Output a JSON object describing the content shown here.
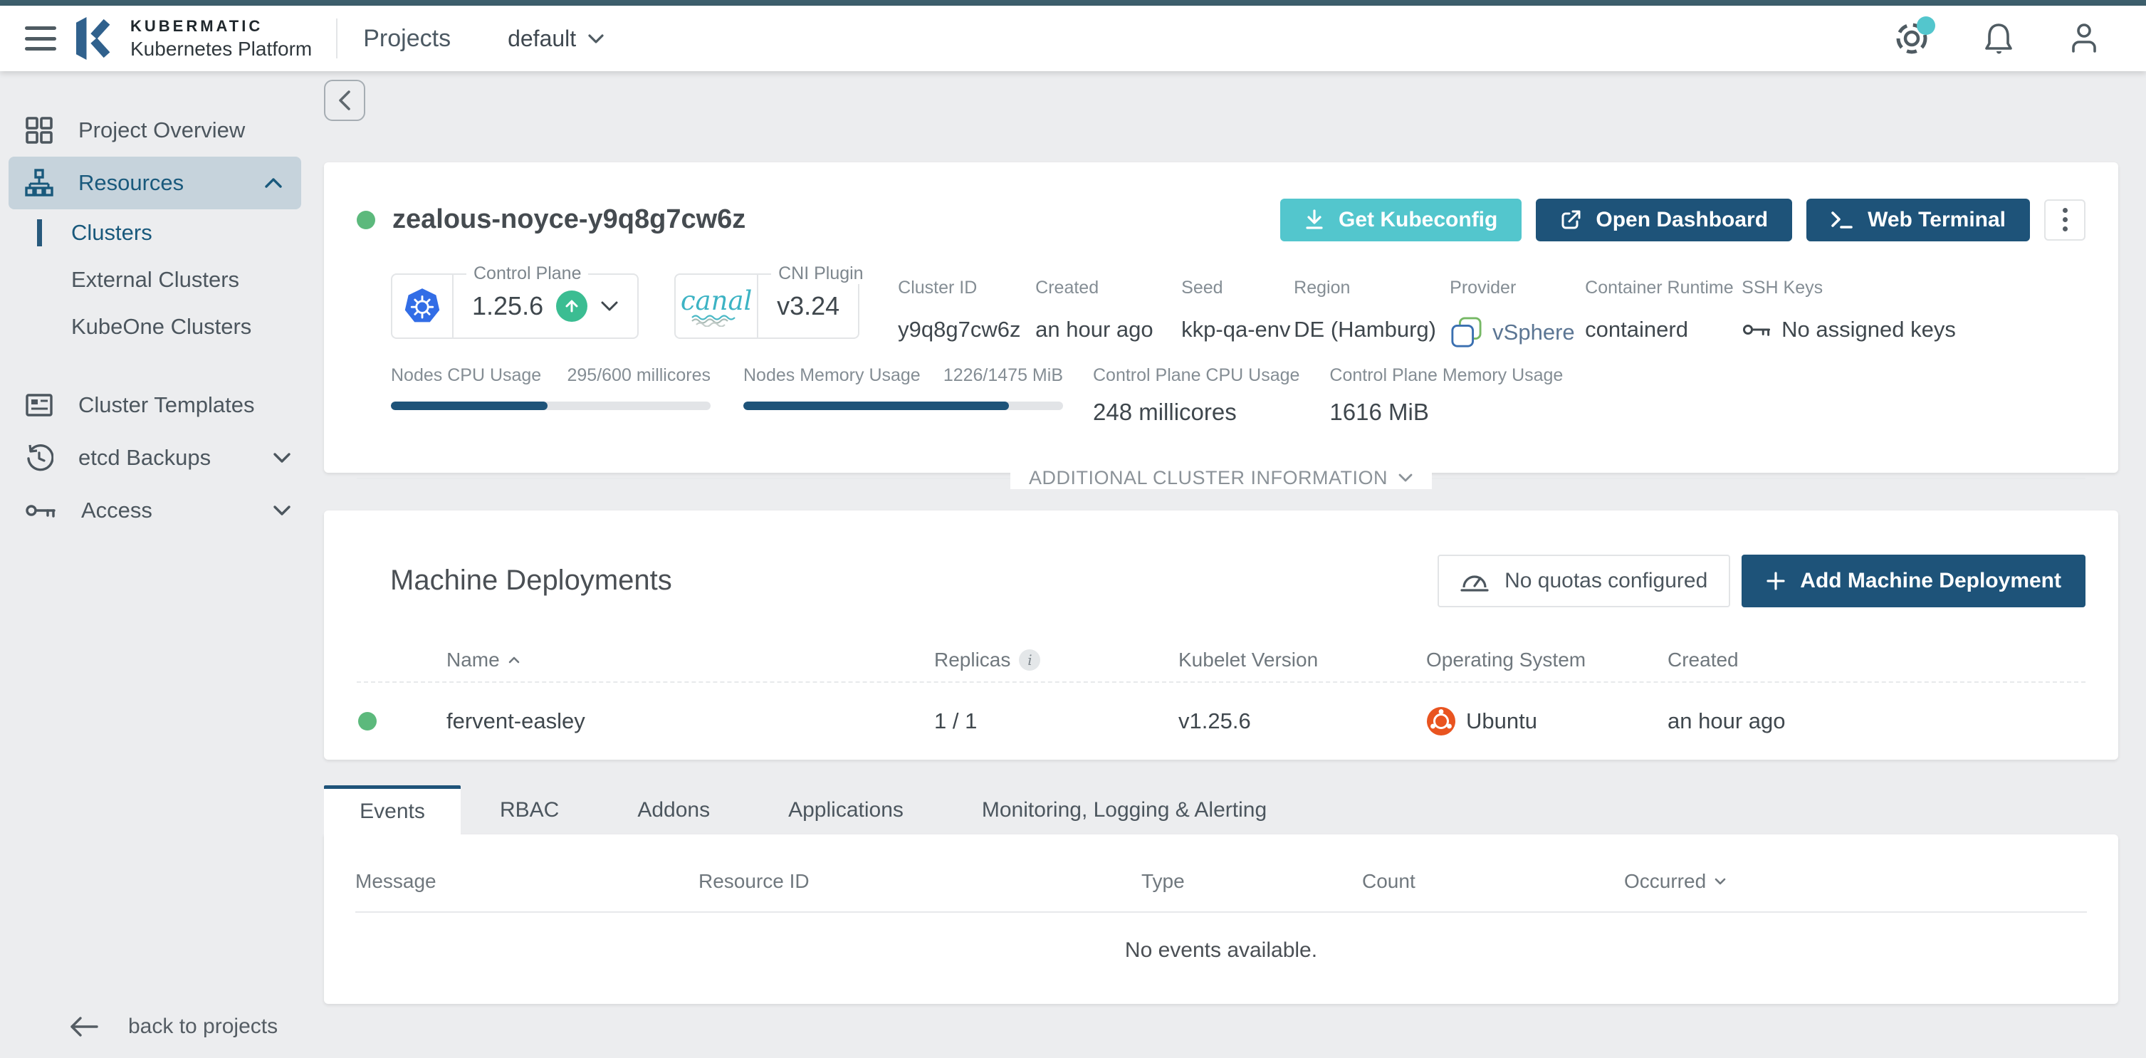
{
  "topbar": {
    "brand_line1": "KUBERMATIC",
    "brand_line2": "Kubernetes Platform",
    "nav_title": "Projects",
    "project_selector": "default"
  },
  "sidebar": {
    "items": [
      {
        "label": "Project Overview"
      },
      {
        "label": "Resources"
      },
      {
        "label": "Clusters"
      },
      {
        "label": "External Clusters"
      },
      {
        "label": "KubeOne Clusters"
      },
      {
        "label": "Cluster Templates"
      },
      {
        "label": "etcd Backups"
      },
      {
        "label": "Access"
      }
    ],
    "back_link": "back to projects"
  },
  "cluster": {
    "name": "zealous-noyce-y9q8g7cw6z",
    "status": "healthy",
    "actions": {
      "kubeconfig": "Get Kubeconfig",
      "dashboard": "Open Dashboard",
      "terminal": "Web Terminal"
    },
    "control_plane": {
      "label": "Control Plane",
      "version": "1.25.6"
    },
    "cni": {
      "label": "CNI Plugin",
      "logo_text": "canal",
      "version": "v3.24"
    },
    "attributes": [
      {
        "label": "Cluster ID",
        "value": "y9q8g7cw6z"
      },
      {
        "label": "Created",
        "value": "an hour ago"
      },
      {
        "label": "Seed",
        "value": "kkp-qa-env"
      },
      {
        "label": "Region",
        "value": "DE (Hamburg)"
      },
      {
        "label": "Provider",
        "value": "vSphere"
      },
      {
        "label": "Container Runtime",
        "value": "containerd"
      },
      {
        "label": "SSH Keys",
        "value": "No assigned keys"
      }
    ],
    "usage": {
      "nodes_cpu": {
        "label": "Nodes CPU Usage",
        "value": "295/600 millicores",
        "percent": 49
      },
      "nodes_memory": {
        "label": "Nodes Memory Usage",
        "value": "1226/1475 MiB",
        "percent": 83
      },
      "cp_cpu": {
        "label": "Control Plane CPU Usage",
        "value": "248 millicores"
      },
      "cp_memory": {
        "label": "Control Plane Memory Usage",
        "value": "1616 MiB"
      }
    },
    "additional_info_label": "ADDITIONAL CLUSTER INFORMATION"
  },
  "machine_deployments": {
    "title": "Machine Deployments",
    "quota_button": "No quotas configured",
    "add_button": "Add Machine Deployment",
    "columns": [
      "Name",
      "Replicas",
      "Kubelet Version",
      "Operating System",
      "Created"
    ],
    "rows": [
      {
        "status": "healthy",
        "name": "fervent-easley",
        "replicas": "1 / 1",
        "kubelet_version": "v1.25.6",
        "operating_system": "Ubuntu",
        "created": "an hour ago"
      }
    ]
  },
  "tabs": [
    {
      "label": "Events",
      "active": true
    },
    {
      "label": "RBAC",
      "active": false
    },
    {
      "label": "Addons",
      "active": false
    },
    {
      "label": "Applications",
      "active": false
    },
    {
      "label": "Monitoring, Logging & Alerting",
      "active": false
    }
  ],
  "events": {
    "columns": [
      "Message",
      "Resource ID",
      "Type",
      "Count",
      "Occurred"
    ],
    "empty_message": "No events available."
  },
  "icons": {
    "menu": "hamburger bars",
    "kubermatic-logo": "blue hexagonal K mark",
    "help": "life-buoy circle with teal notification dot",
    "notifications": "bell outline",
    "user": "person outline",
    "project-overview": "grid of four squares",
    "resources": "sitemap nodes",
    "cluster-templates": "card with list lines",
    "etcd-backups": "history clock arrow",
    "access": "key",
    "kubernetes": "blue heptagon helm wheel",
    "upgrade-available": "green circle up arrow",
    "canal": "teal cursive wordmark with waves",
    "download": "arrow down to tray",
    "external-link": "square with outgoing arrow",
    "terminal": "prompt greater-than underscore",
    "kebab-menu": "three vertical dots",
    "vsphere": "two overlapping rounded squares",
    "ssh-key": "key outline",
    "quota-gauge": "speedometer",
    "plus": "plus sign",
    "sort-asc": "chevron up",
    "sort-desc": "chevron down",
    "info": "lowercase i in circle",
    "ubuntu": "orange circle of friends",
    "status-dot": "green filled circle",
    "back-arrow": "left arrow"
  },
  "colors": {
    "topstrip": "#3d5f6c",
    "accent_teal": "#53c6cd",
    "navy": "#1e5379",
    "sidebar_active_bg": "#c6d3dc",
    "sidebar_active_text": "#19597c",
    "green_status": "#5cb97c",
    "green_upgrade": "#3bbd92",
    "k8s_blue": "#326de6",
    "ubuntu_orange": "#e95420",
    "canal_teal": "#3cb3c4",
    "bg_gray": "#ecedef"
  }
}
